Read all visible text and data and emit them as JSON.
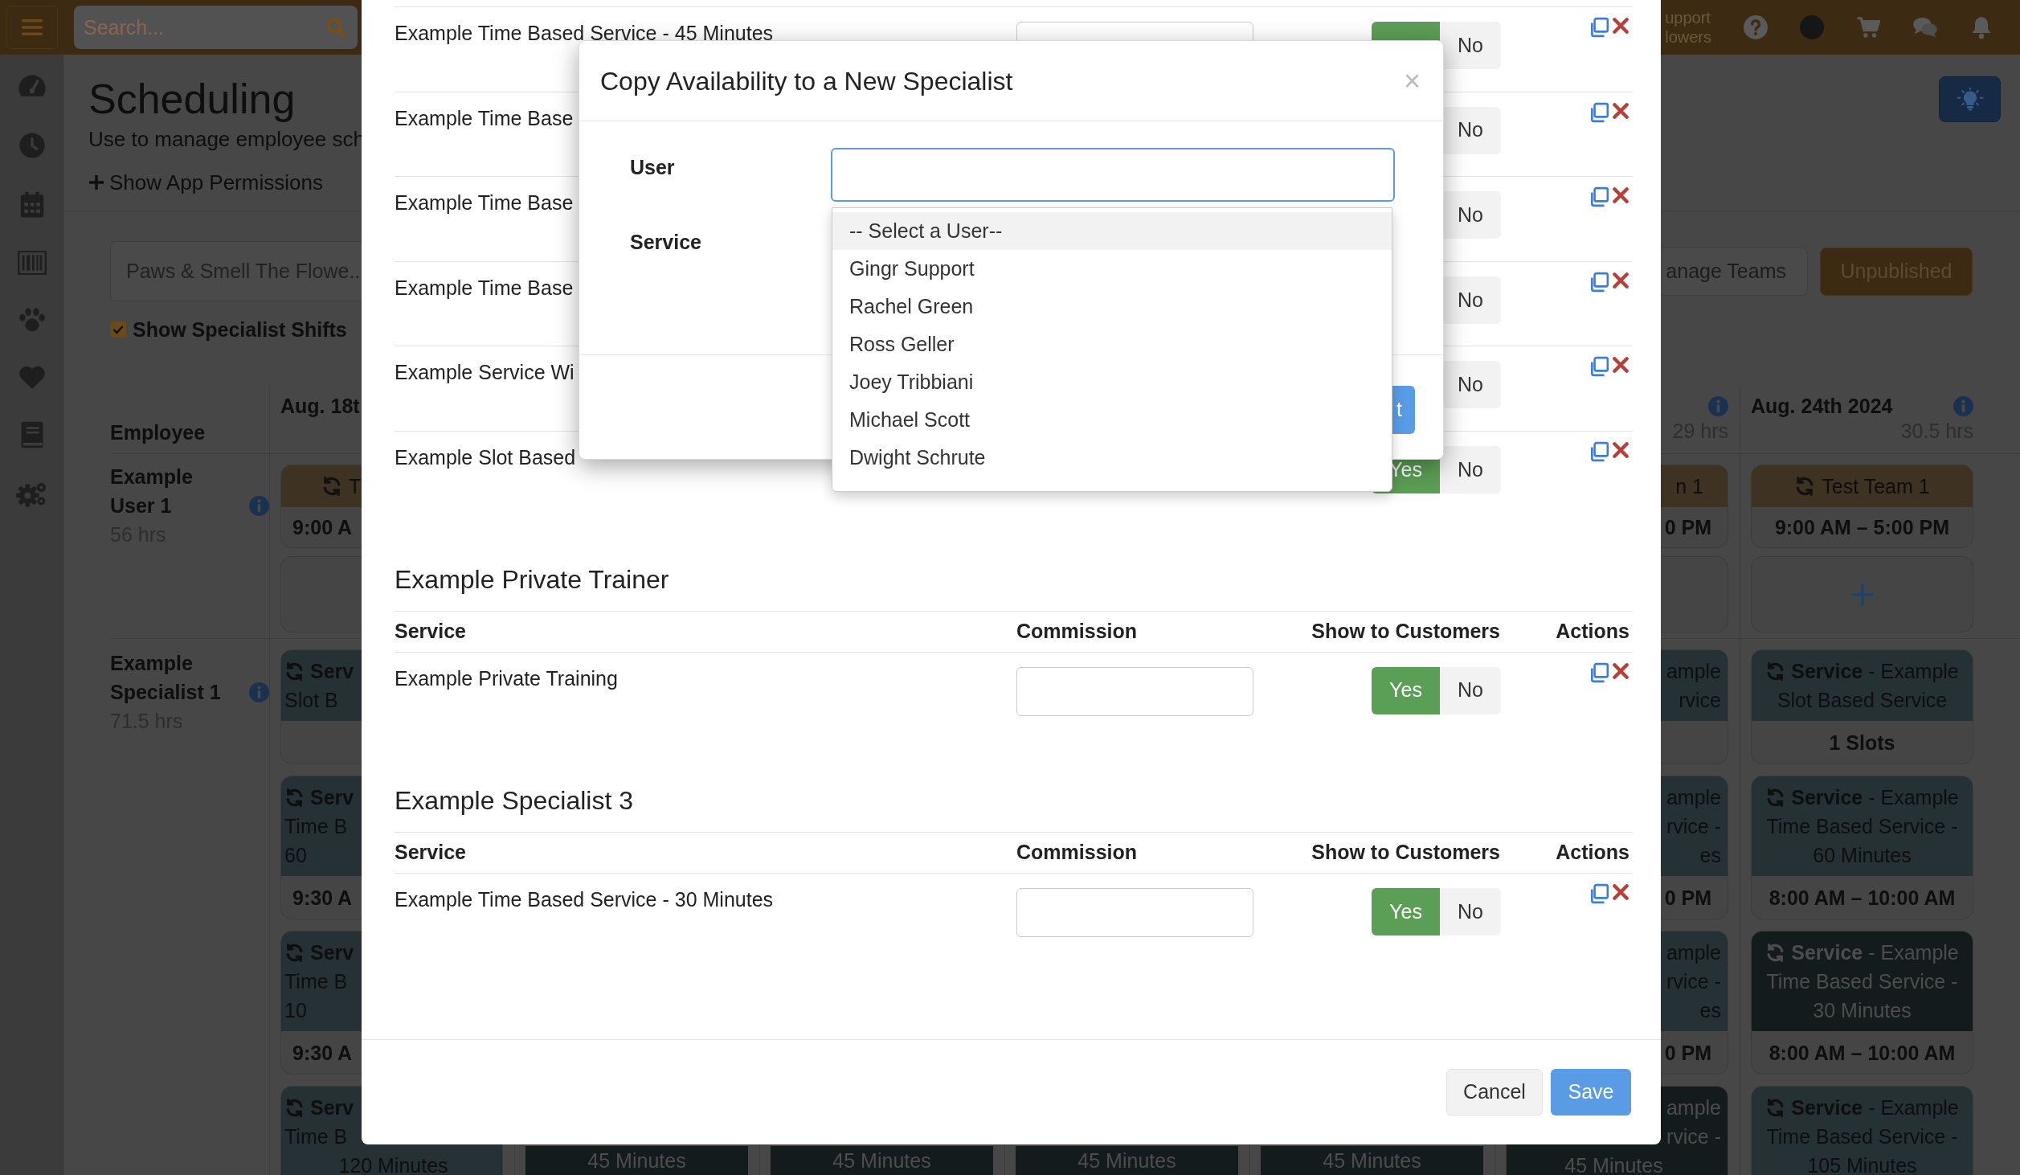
{
  "top_bar": {
    "search": {
      "placeholder": "Search..."
    },
    "account_lines": [
      "upport",
      "lowers"
    ]
  },
  "page": {
    "title": "Scheduling",
    "subtitle": "Use to manage employee sch",
    "permissions_link": "Show App Permissions",
    "location": "Paws & Smell The Flowe..",
    "manage_teams": "anage Teams",
    "publish_status": "Unpublished",
    "show_specialist_shifts": {
      "label": "Show Specialist Shifts",
      "checked": true
    }
  },
  "schedule": {
    "employee_heading": "Employee",
    "employees": [
      {
        "name": "Example User 1",
        "hours": "56 hrs"
      },
      {
        "name": "Example Specialist 1",
        "hours": "71.5 hrs"
      }
    ],
    "days": [
      {
        "kind": "left_part",
        "heading": "Aug. 18t",
        "team_shift": {
          "title": "T",
          "time": "9:00 A"
        },
        "services": [
          {
            "label": "Serv",
            "lines": [
              "Slot B"
            ],
            "dimmed": false
          },
          {
            "label": "Serv",
            "lines": [
              "Time B",
              "60"
            ],
            "time": "9:30 A",
            "dimmed": false
          },
          {
            "label": "Serv",
            "lines": [
              "Time B",
              "10"
            ],
            "time": "9:30 A",
            "dimmed": false
          },
          {
            "label": "Serv",
            "lines": [
              "Time B"
            ],
            "tail": "120 Minutes",
            "dimmed": false
          }
        ]
      },
      {
        "kind": "hidden",
        "services": [
          {
            "tail": "45 Minutes",
            "dimmed": true
          }
        ]
      },
      {
        "kind": "hidden",
        "services": [
          {
            "tail": "45 Minutes",
            "dimmed": true
          }
        ]
      },
      {
        "kind": "hidden",
        "services": [
          {
            "tail": "45 Minutes",
            "dimmed": true
          }
        ]
      },
      {
        "kind": "hidden",
        "services": [
          {
            "tail": "45 Minutes",
            "dimmed": true
          }
        ]
      },
      {
        "kind": "right_part",
        "hours": "29 hrs",
        "team_shift": {
          "title": "n 1",
          "time": "0 PM"
        },
        "services": [
          {
            "lines": [
              "ample",
              "rvice"
            ],
            "dimmed": false
          },
          {
            "lines": [
              "ample",
              "rvice -",
              "es"
            ],
            "time": "0 PM",
            "dimmed": false
          },
          {
            "lines": [
              "ample",
              "rvice -",
              "es"
            ],
            "time": "0 PM",
            "dimmed": false
          },
          {
            "lines": [
              "ample",
              "rvice -"
            ],
            "tail": "45 Minutes",
            "dimmed": true
          }
        ]
      },
      {
        "kind": "full",
        "heading": "Aug. 24th 2024",
        "hours": "30.5 hrs",
        "team_shift": {
          "title": "Test Team 1",
          "time": "9:00 AM – 5:00 PM"
        },
        "services": [
          {
            "label": "Service",
            "lines": [
              "- Example",
              "Slot Based Service"
            ],
            "time": "1 Slots",
            "dimmed": false
          },
          {
            "label": "Service",
            "lines": [
              "- Example",
              "Time Based Service -",
              "60 Minutes"
            ],
            "time": "8:00 AM – 10:00 AM",
            "dimmed": false
          },
          {
            "label": "Service",
            "lines": [
              "- Example",
              "Time Based Service -",
              "30 Minutes"
            ],
            "time": "8:00 AM – 10:00 AM",
            "dimmed": true
          },
          {
            "label": "Service",
            "lines": [
              "- Example",
              "Time Based Service -",
              "105 Minutes"
            ],
            "dimmed": false
          }
        ]
      }
    ]
  },
  "modal": {
    "top_rows": [
      {
        "kind": "top",
        "service": "Example Time Based Service - 45 Minutes",
        "visible_to_customers": true,
        "no_label": "No"
      },
      {
        "kind": "covered",
        "service": "Example Time Base",
        "visible_to_customers": true,
        "no_label": "No"
      },
      {
        "kind": "covered",
        "service": "Example Time Base",
        "visible_to_customers": true,
        "no_label": "No"
      },
      {
        "kind": "covered",
        "service": "Example Time Base",
        "visible_to_customers": true,
        "no_label": "No"
      },
      {
        "kind": "covered",
        "service": "Example Service Wi",
        "visible_to_customers": true,
        "no_label": "No"
      },
      {
        "kind": "partly_covered",
        "service": "Example Slot Based",
        "visible_to_customers": true,
        "yes_label": "Yes",
        "no_label": "No"
      }
    ],
    "sections": [
      {
        "title": "Example Private Trainer",
        "columns": [
          "Service",
          "Commission",
          "Show to Customers",
          "Actions"
        ],
        "rows": [
          {
            "kind": "full",
            "service": "Example Private Training",
            "visible_to_customers": true,
            "yes_label": "Yes",
            "no_label": "No"
          }
        ]
      },
      {
        "title": "Example Specialist 3",
        "columns": [
          "Service",
          "Commission",
          "Show to Customers",
          "Actions"
        ],
        "rows": [
          {
            "kind": "full",
            "service": "Example Time Based Service - 30 Minutes",
            "visible_to_customers": true,
            "yes_label": "Yes",
            "no_label": "No"
          }
        ]
      }
    ],
    "buttons": {
      "cancel": "Cancel",
      "save": "Save"
    }
  },
  "copy_dialog": {
    "title": "Copy Availability to a New Specialist",
    "close": "×",
    "fields": [
      {
        "label": "User"
      },
      {
        "label": "Service"
      }
    ],
    "submit_label": "t",
    "user_options": [
      {
        "label": "-- Select a User--",
        "selected": true
      },
      {
        "label": "Gingr Support",
        "selected": false
      },
      {
        "label": "Rachel Green",
        "selected": false
      },
      {
        "label": "Ross Geller",
        "selected": false
      },
      {
        "label": "Joey Tribbiani",
        "selected": false
      },
      {
        "label": "Michael Scott",
        "selected": false
      },
      {
        "label": "Dwight Schrute",
        "selected": false
      }
    ]
  }
}
